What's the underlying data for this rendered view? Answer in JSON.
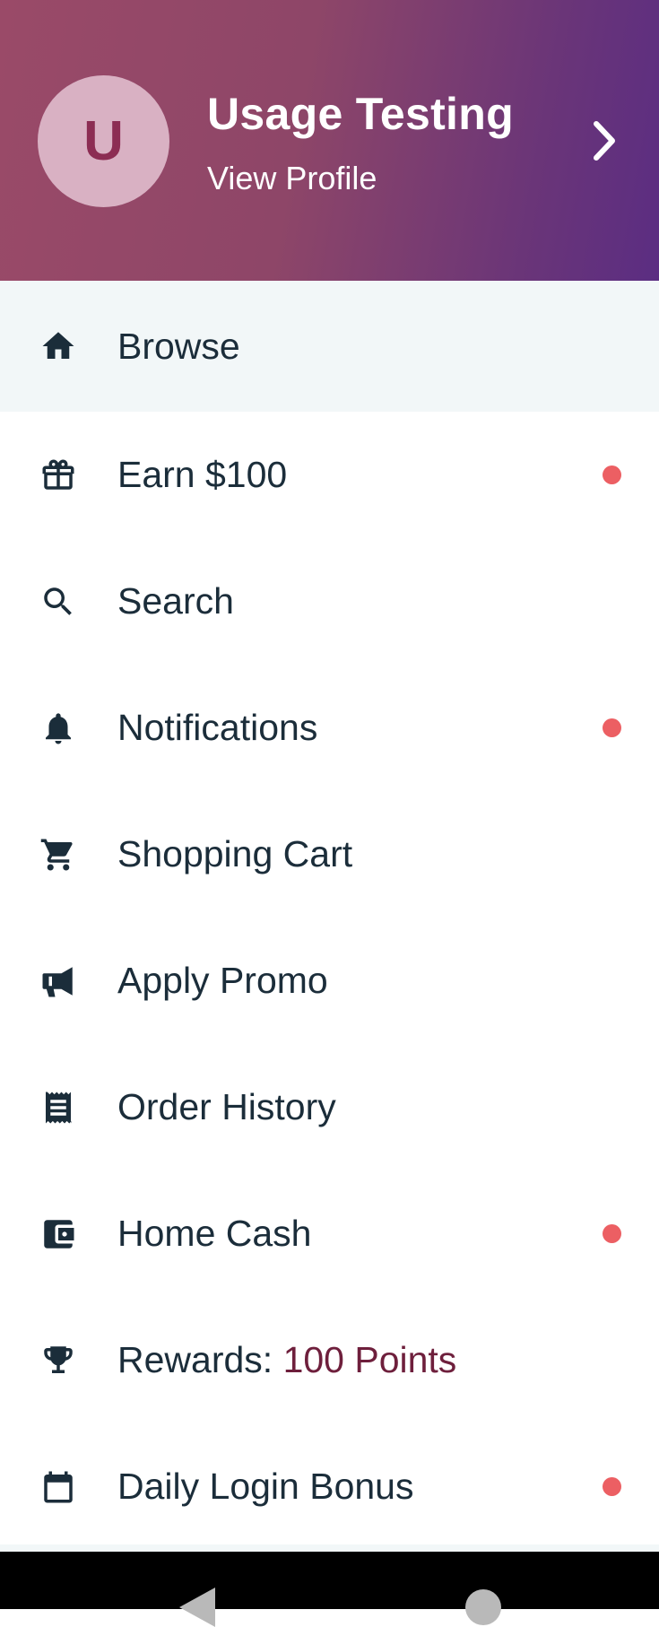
{
  "profile": {
    "avatar_initial": "U",
    "name": "Usage Testing",
    "link_label": "View Profile"
  },
  "menu": {
    "items": [
      {
        "label": "Browse",
        "icon": "home-icon",
        "active": true,
        "dot": false
      },
      {
        "label": "Earn $100",
        "icon": "gift-icon",
        "dot": true
      },
      {
        "label": "Search",
        "icon": "search-icon",
        "dot": false
      },
      {
        "label": "Notifications",
        "icon": "bell-icon",
        "dot": true
      },
      {
        "label": "Shopping Cart",
        "icon": "cart-icon",
        "dot": false
      },
      {
        "label": "Apply Promo",
        "icon": "megaphone-icon",
        "dot": false
      },
      {
        "label": "Order History",
        "icon": "receipt-icon",
        "dot": false
      },
      {
        "label": "Home Cash",
        "icon": "wallet-icon",
        "dot": true
      },
      {
        "label": "Rewards: ",
        "value": "100 Points",
        "icon": "trophy-icon",
        "dot": false
      },
      {
        "label": "Daily Login Bonus",
        "icon": "calendar-icon",
        "dot": true
      }
    ]
  },
  "colors": {
    "header_gradient_start": "#9a4a68",
    "header_gradient_end": "#5b2d82",
    "active_row_bg": "#f2f7f8",
    "dot": "#ec5f63",
    "accent_text": "#6e1f3c"
  }
}
